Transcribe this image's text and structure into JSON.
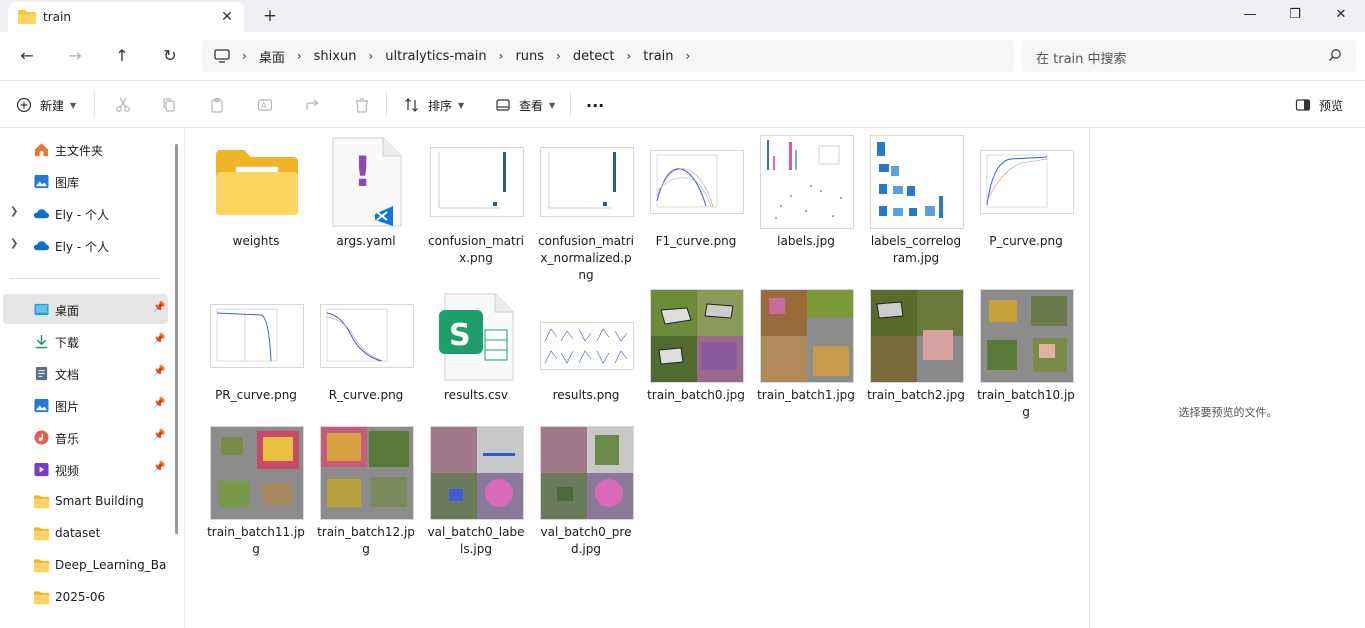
{
  "window": {
    "tab_title": "train",
    "tab_close": "✕",
    "new_tab": "+",
    "minimize": "—",
    "maximize": "❐",
    "close": "✕"
  },
  "nav": {
    "back": "←",
    "forward": "→",
    "up": "↑",
    "refresh": "↻",
    "breadcrumb": [
      "桌面",
      "shixun",
      "ultralytics-main",
      "runs",
      "detect",
      "train"
    ],
    "separator": "›",
    "search_placeholder": "在 train 中搜索"
  },
  "toolbar": {
    "new_label": "新建",
    "sort_label": "排序",
    "view_label": "查看",
    "more_label": "···",
    "preview_label": "预览"
  },
  "sidebar": {
    "items": [
      {
        "label": "主文件夹",
        "icon": "home-icon",
        "pin": false,
        "expander": false
      },
      {
        "label": "图库",
        "icon": "gallery-icon",
        "pin": false,
        "expander": false
      },
      {
        "label": "Ely - 个人",
        "icon": "onedrive-icon",
        "pin": false,
        "expander": true
      },
      {
        "label": "Ely - 个人",
        "icon": "onedrive-icon",
        "pin": false,
        "expander": true
      },
      {
        "label": "桌面",
        "icon": "desktop-icon",
        "pin": true,
        "expander": false,
        "selected": true
      },
      {
        "label": "下载",
        "icon": "download-icon",
        "pin": true,
        "expander": false
      },
      {
        "label": "文档",
        "icon": "document-icon",
        "pin": true,
        "expander": false
      },
      {
        "label": "图片",
        "icon": "pictures-icon",
        "pin": true,
        "expander": false
      },
      {
        "label": "音乐",
        "icon": "music-icon",
        "pin": true,
        "expander": false
      },
      {
        "label": "视频",
        "icon": "video-icon",
        "pin": true,
        "expander": false
      },
      {
        "label": "Smart Building",
        "icon": "folder-icon",
        "pin": false,
        "expander": false
      },
      {
        "label": "dataset",
        "icon": "folder-icon",
        "pin": false,
        "expander": false
      },
      {
        "label": "Deep_Learning_Bas",
        "icon": "folder-icon",
        "pin": false,
        "expander": false
      },
      {
        "label": "2025-06",
        "icon": "folder-icon",
        "pin": false,
        "expander": false
      }
    ]
  },
  "files": [
    {
      "name": "weights",
      "kind": "folder"
    },
    {
      "name": "args.yaml",
      "kind": "yaml"
    },
    {
      "name": "confusion_matri\nx.png",
      "kind": "plot-matrix"
    },
    {
      "name": "confusion_matri\nx_normalized.p\nng",
      "kind": "plot-matrix"
    },
    {
      "name": "F1_curve.png",
      "kind": "plot-curve"
    },
    {
      "name": "labels.jpg",
      "kind": "plot-labels"
    },
    {
      "name": "labels_correlog\nram.jpg",
      "kind": "plot-corr"
    },
    {
      "name": "P_curve.png",
      "kind": "plot-curve"
    },
    {
      "name": "PR_curve.png",
      "kind": "plot-curve"
    },
    {
      "name": "R_curve.png",
      "kind": "plot-curve"
    },
    {
      "name": "results.csv",
      "kind": "csv"
    },
    {
      "name": "results.png",
      "kind": "plot-results"
    },
    {
      "name": "train_batch0.jpg",
      "kind": "photo-grid"
    },
    {
      "name": "train_batch1.jpg",
      "kind": "photo-grid"
    },
    {
      "name": "train_batch2.jpg",
      "kind": "photo-grid"
    },
    {
      "name": "train_batch10.jp\ng",
      "kind": "photo-grid"
    },
    {
      "name": "train_batch11.jp\ng",
      "kind": "photo-grid"
    },
    {
      "name": "train_batch12.jp\ng",
      "kind": "photo-grid"
    },
    {
      "name": "val_batch0_labe\nls.jpg",
      "kind": "photo-grid"
    },
    {
      "name": "val_batch0_pre\nd.jpg",
      "kind": "photo-grid"
    }
  ],
  "preview": {
    "empty_text": "选择要预览的文件。"
  },
  "colors": {
    "accent": "#0067c0",
    "folder": "#f8c33c",
    "excel": "#1e9e6b",
    "vscode": "#0a7ad6",
    "yaml_mark": "#8a4bb8"
  }
}
